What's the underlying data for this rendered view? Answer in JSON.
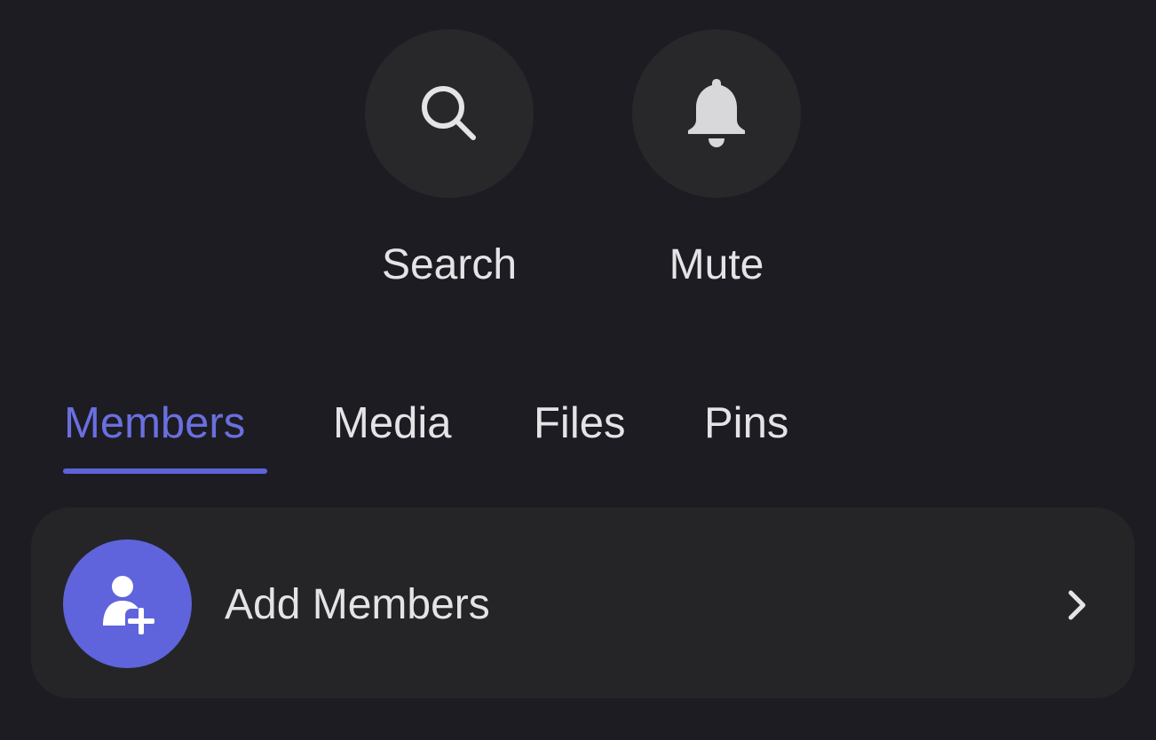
{
  "actions": {
    "search": {
      "label": "Search",
      "icon": "search-icon"
    },
    "mute": {
      "label": "Mute",
      "icon": "bell-icon"
    }
  },
  "tabs": [
    {
      "label": "Members",
      "active": true
    },
    {
      "label": "Media",
      "active": false
    },
    {
      "label": "Files",
      "active": false
    },
    {
      "label": "Pins",
      "active": false
    }
  ],
  "add_members": {
    "label": "Add Members",
    "icon": "add-user-icon",
    "chevron": "chevron-right-icon"
  },
  "colors": {
    "background": "#1d1c22",
    "accent": "#6a6fe0",
    "card": "#252528",
    "action_circle": "#28282b",
    "text": "#e4e4e6"
  }
}
